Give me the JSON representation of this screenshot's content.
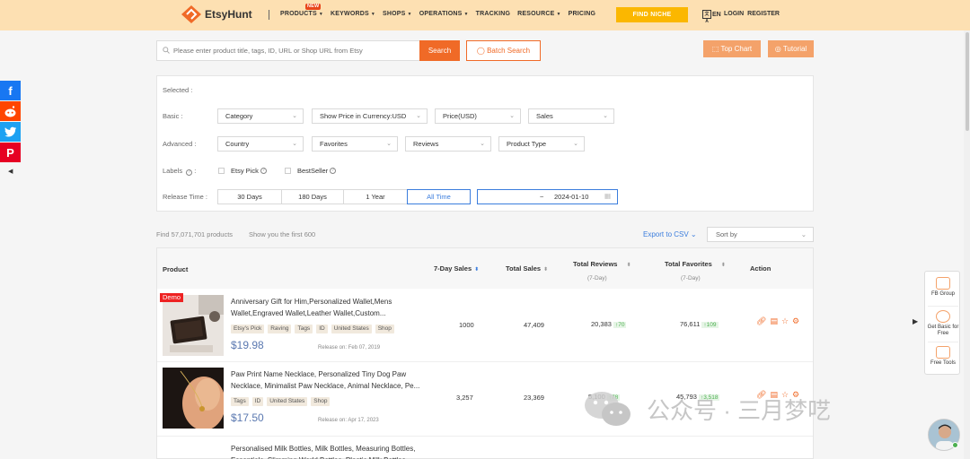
{
  "nav": {
    "logo_text": "EtsyHunt",
    "links": [
      {
        "label": "PRODUCTS",
        "caret": true,
        "badge": "NEW"
      },
      {
        "label": "KEYWORDS",
        "caret": true
      },
      {
        "label": "SHOPS",
        "caret": true
      },
      {
        "label": "OPERATIONS",
        "caret": true
      },
      {
        "label": "TRACKING",
        "caret": false
      },
      {
        "label": "RESOURCE",
        "caret": true
      },
      {
        "label": "PRICING",
        "caret": false
      }
    ],
    "find_niche": "FIND NICHE",
    "lang_icon": "文A",
    "lang": "EN",
    "login": "LOGIN",
    "register": "REGISTER"
  },
  "search": {
    "placeholder": "Please enter product title, tags, ID, URL or Shop URL from Etsy",
    "button": "Search",
    "batch": "Batch Search",
    "top_chart": "Top Chart",
    "tutorial": "Tutorial"
  },
  "filters": {
    "selected_label": "Selected :",
    "basic_label": "Basic :",
    "advanced_label": "Advanced :",
    "labels_label": "Labels",
    "release_label": "Release Time :",
    "basic": [
      "Category",
      "Show Price in Currency:USD",
      "Price(USD)",
      "Sales"
    ],
    "advanced": [
      "Country",
      "Favorites",
      "Reviews",
      "Product Type"
    ],
    "labels": [
      "Etsy Pick",
      "BestSeller"
    ],
    "time_options": [
      "30 Days",
      "180 Days",
      "1 Year",
      "All Time"
    ],
    "active_time": "All Time",
    "date_sep": "~",
    "date_end": "2024-01-10"
  },
  "summary": {
    "found": "Find 57,071,701 products",
    "showing": "Show you the first 600",
    "export": "Export to CSV",
    "sort": "Sort by"
  },
  "table": {
    "headers": {
      "product": "Product",
      "sales7": "7-Day Sales",
      "total_sales": "Total Sales",
      "total_reviews": "Total Reviews",
      "reviews_sub": "(7-Day)",
      "total_favorites": "Total Favorites",
      "favorites_sub": "(7-Day)",
      "action": "Action"
    },
    "rows": [
      {
        "demo": "Demo",
        "title": "Anniversary Gift for Him,Personalized Wallet,Mens Wallet,Engraved Wallet,Leather Wallet,Custom...",
        "tags": [
          "Etsy's Pick",
          "Raving",
          "Tags",
          "ID",
          "United States",
          "Shop"
        ],
        "price": "$19.98",
        "release": "Release on: Feb 07, 2019",
        "sales7": "1000",
        "total_sales": "47,409",
        "reviews": "20,383",
        "reviews_delta": "↑70",
        "favorites": "76,611",
        "favorites_delta": "↑109"
      },
      {
        "title": "Paw Print Name Necklace, Personalized Tiny Dog Paw Necklace, Minimalist Paw Necklace, Animal Necklace, Pe...",
        "tags": [
          "Tags",
          "ID",
          "United States",
          "Shop"
        ],
        "price": "$17.50",
        "release": "Release on: Apr 17, 2023",
        "sales7": "3,257",
        "total_sales": "23,369",
        "reviews": "5,100",
        "reviews_delta": "↑78",
        "favorites": "45,793",
        "favorites_delta": "↑3,518"
      },
      {
        "title": "Personalised Milk Bottles, Milk Bottles, Measuring Bottles, Essentials, Slimming World Bottles, Plastic Milk Bottles..."
      }
    ]
  },
  "watermark": {
    "text": "公众号 · 三月梦呓"
  },
  "float": {
    "fb_group": "FB Group",
    "get_basic": "Get Basic for Free",
    "free_tools": "Free Tools"
  },
  "colors": {
    "brand_orange": "#f06a27",
    "nav_bg": "#fde0b2",
    "find_niche": "#fbb700",
    "link_blue": "#3b7ddd"
  }
}
